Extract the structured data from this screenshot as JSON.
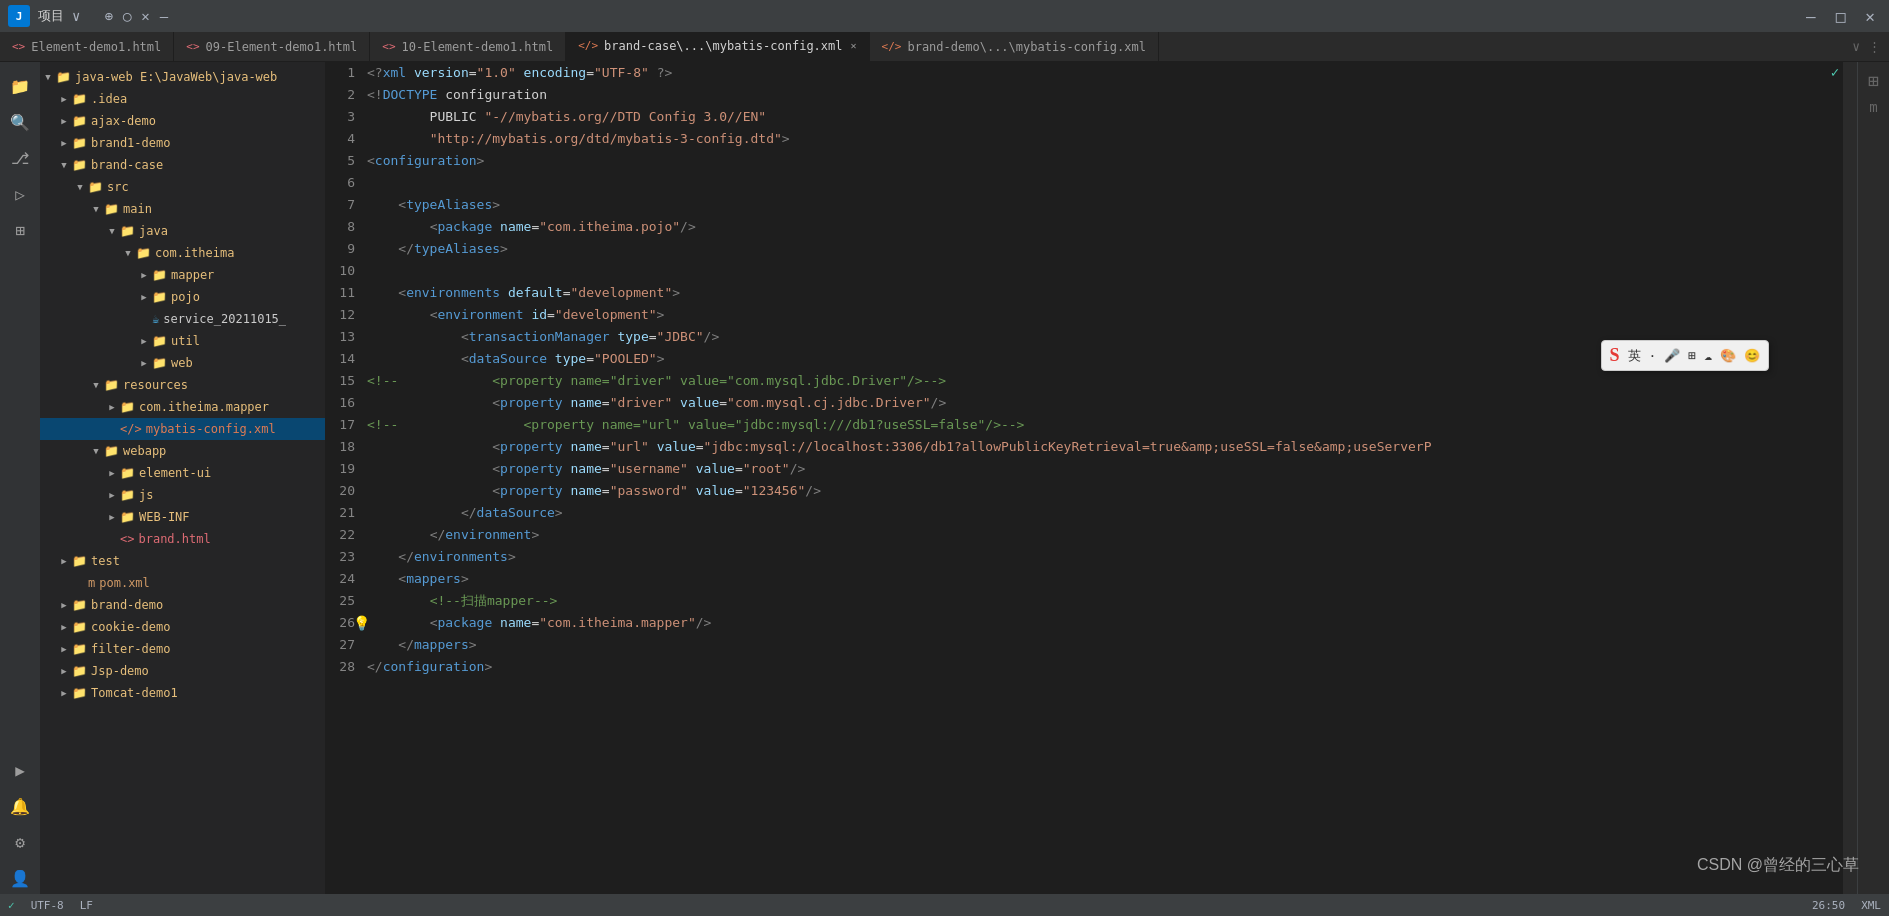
{
  "topbar": {
    "logo": "J",
    "project": "项目",
    "project_chevron": "∨",
    "icons": [
      "↻",
      "⟲",
      "✕",
      "–"
    ]
  },
  "tabs": [
    {
      "label": "Element-demo1.html",
      "icon": "",
      "active": false,
      "closable": false
    },
    {
      "label": "09-Element-demo1.html",
      "icon": "<>",
      "active": false,
      "closable": false
    },
    {
      "label": "10-Element-demo1.html",
      "icon": "<>",
      "active": false,
      "closable": false
    },
    {
      "label": "brand-case\\...\\mybatis-config.xml",
      "icon": "</>",
      "active": true,
      "closable": true
    },
    {
      "label": "brand-demo\\...\\mybatis-config.xml",
      "icon": "</>",
      "active": false,
      "closable": false
    }
  ],
  "filetree": {
    "root": "java-web",
    "root_path": "E:\\JavaWeb\\java-web",
    "items": [
      {
        "level": 0,
        "type": "folder",
        "label": "java-web E:\\JavaWeb\\java-web",
        "expanded": true,
        "arrow": "▼"
      },
      {
        "level": 1,
        "type": "folder",
        "label": ".idea",
        "expanded": false,
        "arrow": "▶"
      },
      {
        "level": 1,
        "type": "folder",
        "label": "ajax-demo",
        "expanded": false,
        "arrow": "▶"
      },
      {
        "level": 1,
        "type": "folder",
        "label": "brand1-demo",
        "expanded": false,
        "arrow": "▶"
      },
      {
        "level": 1,
        "type": "folder",
        "label": "brand-case",
        "expanded": true,
        "arrow": "▼"
      },
      {
        "level": 2,
        "type": "folder",
        "label": "src",
        "expanded": true,
        "arrow": "▼"
      },
      {
        "level": 3,
        "type": "folder",
        "label": "main",
        "expanded": true,
        "arrow": "▼"
      },
      {
        "level": 4,
        "type": "folder",
        "label": "java",
        "expanded": true,
        "arrow": "▼"
      },
      {
        "level": 5,
        "type": "folder",
        "label": "com.itheima",
        "expanded": true,
        "arrow": "▼"
      },
      {
        "level": 6,
        "type": "folder",
        "label": "mapper",
        "expanded": false,
        "arrow": "▶"
      },
      {
        "level": 6,
        "type": "folder",
        "label": "pojo",
        "expanded": false,
        "arrow": "▶"
      },
      {
        "level": 6,
        "type": "file",
        "label": "service_20211015_",
        "file_type": "java"
      },
      {
        "level": 6,
        "type": "folder",
        "label": "util",
        "expanded": false,
        "arrow": "▶"
      },
      {
        "level": 6,
        "type": "folder",
        "label": "web",
        "expanded": false,
        "arrow": "▶"
      },
      {
        "level": 3,
        "type": "folder",
        "label": "resources",
        "expanded": true,
        "arrow": "▼"
      },
      {
        "level": 4,
        "type": "folder",
        "label": "com.itheima.mapper",
        "expanded": false,
        "arrow": "▶"
      },
      {
        "level": 4,
        "type": "file",
        "label": "mybatis-config.xml",
        "file_type": "xml",
        "selected": true
      },
      {
        "level": 3,
        "type": "folder",
        "label": "webapp",
        "expanded": true,
        "arrow": "▼"
      },
      {
        "level": 4,
        "type": "folder",
        "label": "element-ui",
        "expanded": false,
        "arrow": "▶"
      },
      {
        "level": 4,
        "type": "folder",
        "label": "js",
        "expanded": false,
        "arrow": "▶"
      },
      {
        "level": 4,
        "type": "folder",
        "label": "WEB-INF",
        "expanded": false,
        "arrow": "▶"
      },
      {
        "level": 4,
        "type": "file",
        "label": "brand.html",
        "file_type": "html"
      },
      {
        "level": 1,
        "type": "folder",
        "label": "test",
        "expanded": false,
        "arrow": "▶"
      },
      {
        "level": 2,
        "type": "file",
        "label": "pom.xml",
        "file_type": "pom"
      },
      {
        "level": 1,
        "type": "folder",
        "label": "brand-demo",
        "expanded": false,
        "arrow": "▶"
      },
      {
        "level": 1,
        "type": "folder",
        "label": "cookie-demo",
        "expanded": false,
        "arrow": "▶"
      },
      {
        "level": 1,
        "type": "folder",
        "label": "filter-demo",
        "expanded": false,
        "arrow": "▶"
      },
      {
        "level": 1,
        "type": "folder",
        "label": "Jsp-demo",
        "expanded": false,
        "arrow": "▶"
      },
      {
        "level": 1,
        "type": "folder",
        "label": "Tomcat-demo1",
        "expanded": false,
        "arrow": "▶"
      }
    ]
  },
  "code": {
    "lines": [
      {
        "num": 1,
        "content": "<?xml version=\"1.0\" encoding=\"UTF-8\" ?>",
        "type": "decl"
      },
      {
        "num": 2,
        "content": "<!DOCTYPE configuration",
        "type": "doctype"
      },
      {
        "num": 3,
        "content": "        PUBLIC \"-//mybatis.org//DTD Config 3.0//EN\"",
        "type": "doctype2"
      },
      {
        "num": 4,
        "content": "        \"http://mybatis.org/dtd/mybatis-3-config.dtd\">",
        "type": "doctype3"
      },
      {
        "num": 5,
        "content": "<configuration>",
        "type": "tag"
      },
      {
        "num": 6,
        "content": "",
        "type": "empty"
      },
      {
        "num": 7,
        "content": "    <typeAliases>",
        "type": "tag"
      },
      {
        "num": 8,
        "content": "        <package name=\"com.itheima.pojo\"/>",
        "type": "tag_attr"
      },
      {
        "num": 9,
        "content": "    </typeAliases>",
        "type": "tag"
      },
      {
        "num": 10,
        "content": "",
        "type": "empty"
      },
      {
        "num": 11,
        "content": "    <environments default=\"development\">",
        "type": "tag_attr"
      },
      {
        "num": 12,
        "content": "        <environment id=\"development\">",
        "type": "tag_attr"
      },
      {
        "num": 13,
        "content": "            <transactionManager type=\"JDBC\"/>",
        "type": "tag_attr"
      },
      {
        "num": 14,
        "content": "            <dataSource type=\"POOLED\">",
        "type": "tag_attr"
      },
      {
        "num": 15,
        "content": "<!--            <property name=\"driver\" value=\"com.mysql.jdbc.Driver\"/>-->",
        "type": "comment"
      },
      {
        "num": 16,
        "content": "                <property name=\"driver\" value=\"com.mysql.cj.jdbc.Driver\"/>",
        "type": "tag_attr"
      },
      {
        "num": 17,
        "content": "<!--                <property name=\"url\" value=\"jdbc:mysql:///db1?useSSL=false\"/>-->",
        "type": "comment"
      },
      {
        "num": 18,
        "content": "                <property name=\"url\" value=\"jdbc:mysql://localhost:3306/db1?allowPublicKeyRetrieval=true&amp;useSSL=false&amp;useServerP",
        "type": "tag_attr"
      },
      {
        "num": 19,
        "content": "                <property name=\"username\" value=\"root\"/>",
        "type": "tag_attr"
      },
      {
        "num": 20,
        "content": "                <property name=\"password\" value=\"123456\"/>",
        "type": "tag_attr"
      },
      {
        "num": 21,
        "content": "            </dataSource>",
        "type": "tag"
      },
      {
        "num": 22,
        "content": "        </environment>",
        "type": "tag"
      },
      {
        "num": 23,
        "content": "    </environments>",
        "type": "tag"
      },
      {
        "num": 24,
        "content": "    <mappers>",
        "type": "tag"
      },
      {
        "num": 25,
        "content": "        <!--扫描mapper-->",
        "type": "comment"
      },
      {
        "num": 26,
        "content": "        <package name=\"com.itheima.mapper\"/>",
        "type": "tag_attr",
        "has_bulb": true
      },
      {
        "num": 27,
        "content": "    </mappers>",
        "type": "tag"
      },
      {
        "num": 28,
        "content": "</configuration>",
        "type": "tag"
      }
    ]
  },
  "ime_toolbar": {
    "s_label": "S",
    "buttons": [
      "英",
      "·",
      "♪",
      "≡",
      "⊞",
      "♠",
      "😊"
    ]
  },
  "csdn_watermark": "CSDN @曾经的三心草",
  "status_bar": {
    "check": "✓",
    "right_icon": "m"
  }
}
